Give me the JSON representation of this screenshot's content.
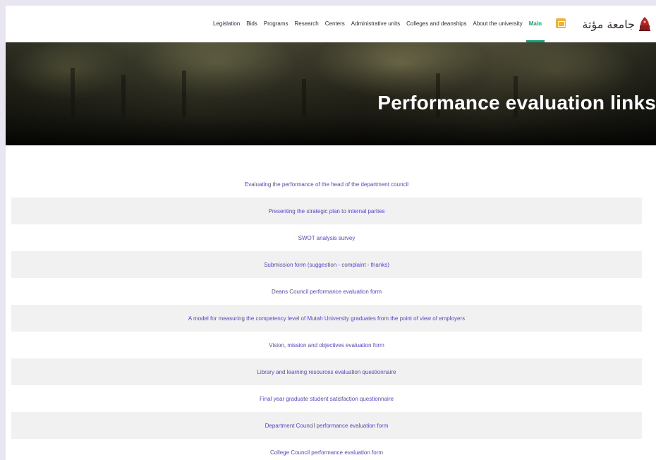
{
  "nav": {
    "items": [
      {
        "label": "Legislation",
        "active": false
      },
      {
        "label": "Bids",
        "active": false
      },
      {
        "label": "Programs",
        "active": false
      },
      {
        "label": "Research",
        "active": false
      },
      {
        "label": "Centers",
        "active": false
      },
      {
        "label": "Administrative units",
        "active": false
      },
      {
        "label": "Colleges and deanships",
        "active": false
      },
      {
        "label": "About the university",
        "active": false
      },
      {
        "label": "Main",
        "active": true
      }
    ],
    "accent_color": "#14a07a"
  },
  "brand": {
    "logo_text": "جامعة مؤتة"
  },
  "banner": {
    "title": "Performance evaluation links"
  },
  "links": [
    "Evaluating the performance of the head of the department council",
    "Presenting the strategic plan to internal parties",
    "SWOT analysis survey",
    "Submission form (suggestion - complaint - thanks)",
    "Deans Council performance evaluation form",
    "A model for measuring the competency level of Mutah University graduates from the point of view of employers",
    "Vision, mission and objectives evaluation form",
    "Library and learning resources evaluation questionnaire",
    "Final year graduate student satisfaction questionnaire",
    "Department Council performance evaluation form",
    "College Council performance evaluation form"
  ],
  "colors": {
    "link": "#5b45c8",
    "row_alt": "#f1f1f1"
  }
}
